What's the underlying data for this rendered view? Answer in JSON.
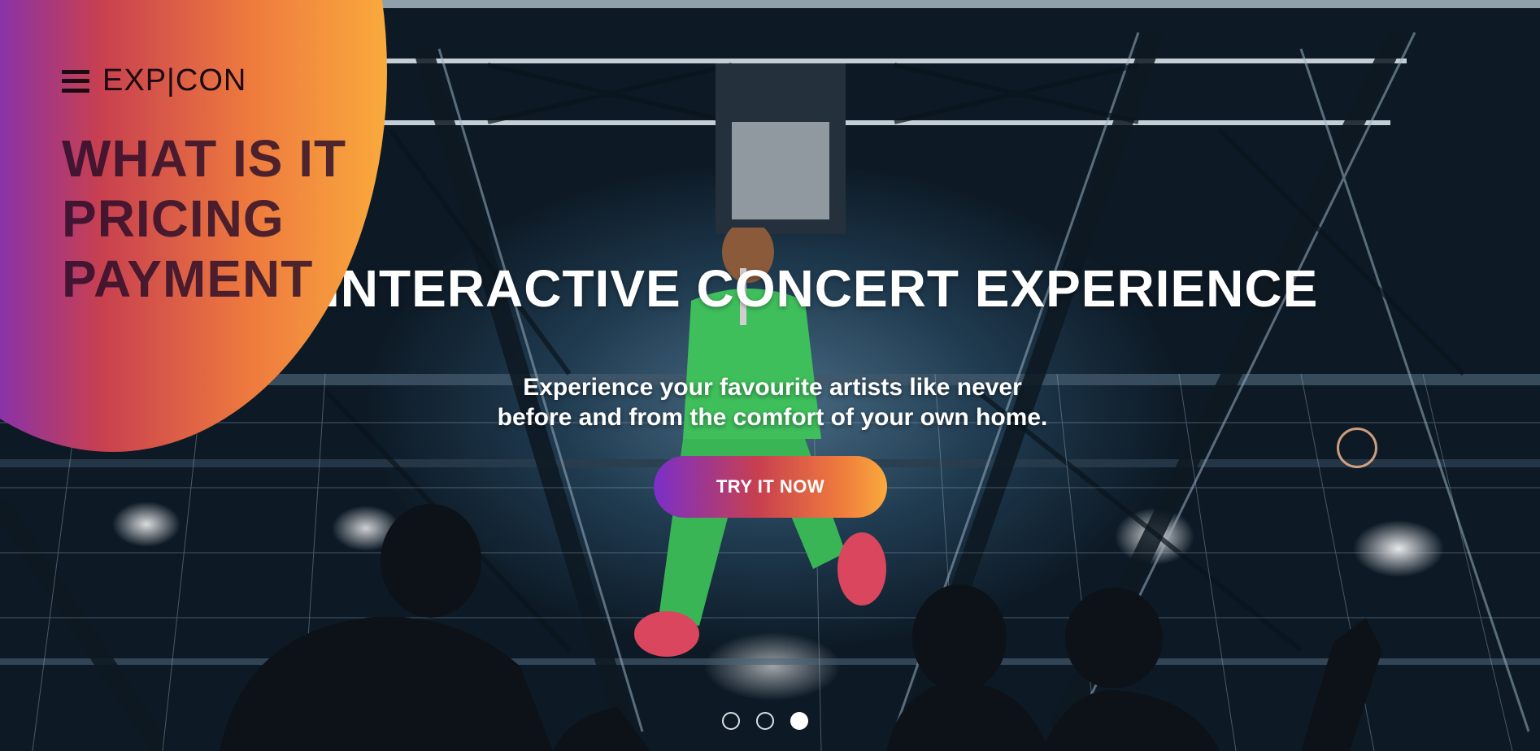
{
  "brand": {
    "name": "EXP|CON"
  },
  "menu": {
    "items": [
      {
        "label": "WHAT IS IT"
      },
      {
        "label": "PRICING"
      },
      {
        "label": "PAYMENT"
      }
    ]
  },
  "hero": {
    "headline": "INTERACTIVE CONCERT EXPERIENCE",
    "subtext_line1": "Experience your favourite artists like never",
    "subtext_line2": "before and from the comfort of your own home.",
    "cta_label": "TRY IT NOW"
  },
  "slider": {
    "count": 3,
    "active_index": 2
  },
  "colors": {
    "gradient_start": "#6a2bd6",
    "gradient_mid": "#c8404f",
    "gradient_end": "#f9aa3d",
    "menu_text": "#280c28"
  },
  "icons": [
    "hamburger-icon",
    "ring-icon"
  ]
}
